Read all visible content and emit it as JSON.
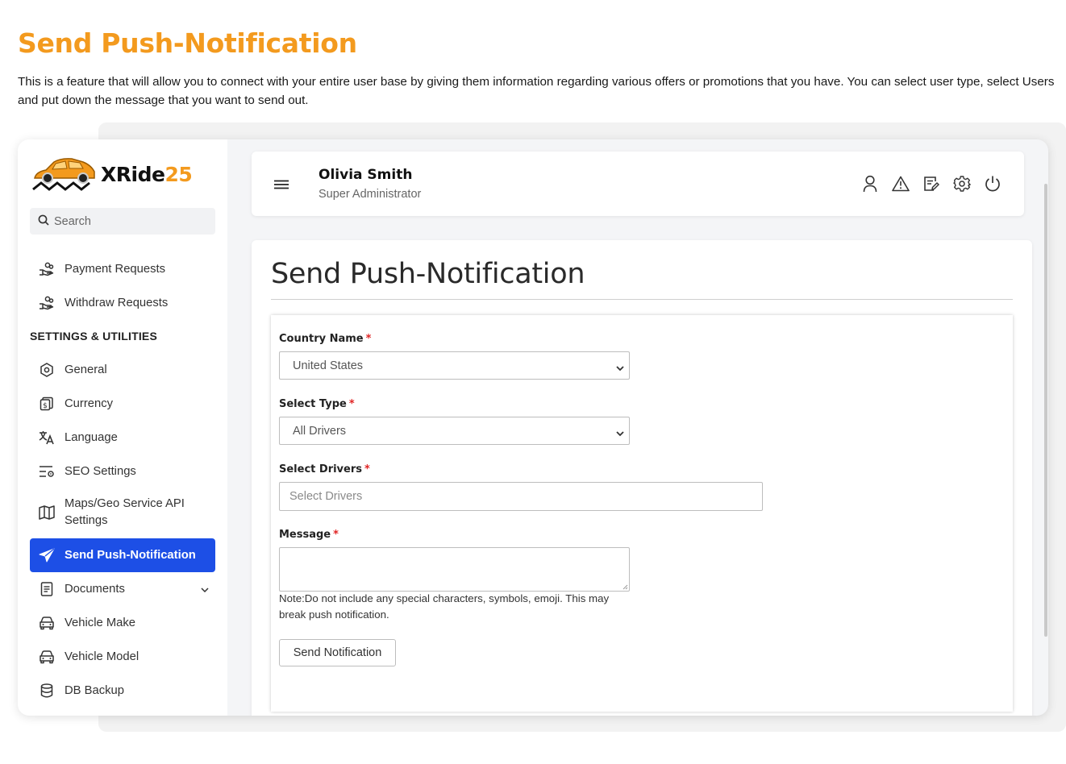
{
  "doc": {
    "title": "Send Push-Notification",
    "description": "This is a feature that will allow you to connect with your entire user base by giving them information regarding various offers or promotions that you have. You can select user type, select Users and put down the message that you want to send out."
  },
  "brand": {
    "name": "XRide",
    "number": "25",
    "accent_color": "#f39a1e",
    "primary_color": "#1d4fe6"
  },
  "sidebar": {
    "search_placeholder": "Search",
    "items_top": [
      {
        "label": "Payment Requests",
        "icon": "hand-coins-icon"
      },
      {
        "label": "Withdraw Requests",
        "icon": "hand-coins-icon"
      }
    ],
    "section_label": "SETTINGS & UTILITIES",
    "items": [
      {
        "label": "General",
        "icon": "hexagon-gear-icon"
      },
      {
        "label": "Currency",
        "icon": "currency-icon"
      },
      {
        "label": "Language",
        "icon": "translate-icon"
      },
      {
        "label": "SEO Settings",
        "icon": "seo-settings-icon"
      },
      {
        "label": "Maps/Geo Service API Settings",
        "icon": "map-icon"
      },
      {
        "label": "Send Push-Notification",
        "icon": "send-icon",
        "active": true
      },
      {
        "label": "Documents",
        "icon": "document-icon"
      },
      {
        "label": "Vehicle Make",
        "icon": "car-icon"
      },
      {
        "label": "Vehicle Model",
        "icon": "car-icon"
      },
      {
        "label": "DB Backup",
        "icon": "database-icon"
      }
    ]
  },
  "header": {
    "user_name": "Olivia Smith",
    "user_role": "Super Administrator",
    "icons": [
      "user-icon",
      "warning-icon",
      "edit-icon",
      "settings-icon",
      "power-icon"
    ]
  },
  "main": {
    "page_title": "Send Push-Notification",
    "form": {
      "country_label": "Country Name",
      "country_value": "United States",
      "type_label": "Select Type",
      "type_value": "All Drivers",
      "drivers_label": "Select Drivers",
      "drivers_placeholder": "Select Drivers",
      "message_label": "Message",
      "required_mark": "*",
      "note": "Note:Do not include any special characters, symbols, emoji. This may break push notification.",
      "submit_label": "Send Notification"
    }
  }
}
